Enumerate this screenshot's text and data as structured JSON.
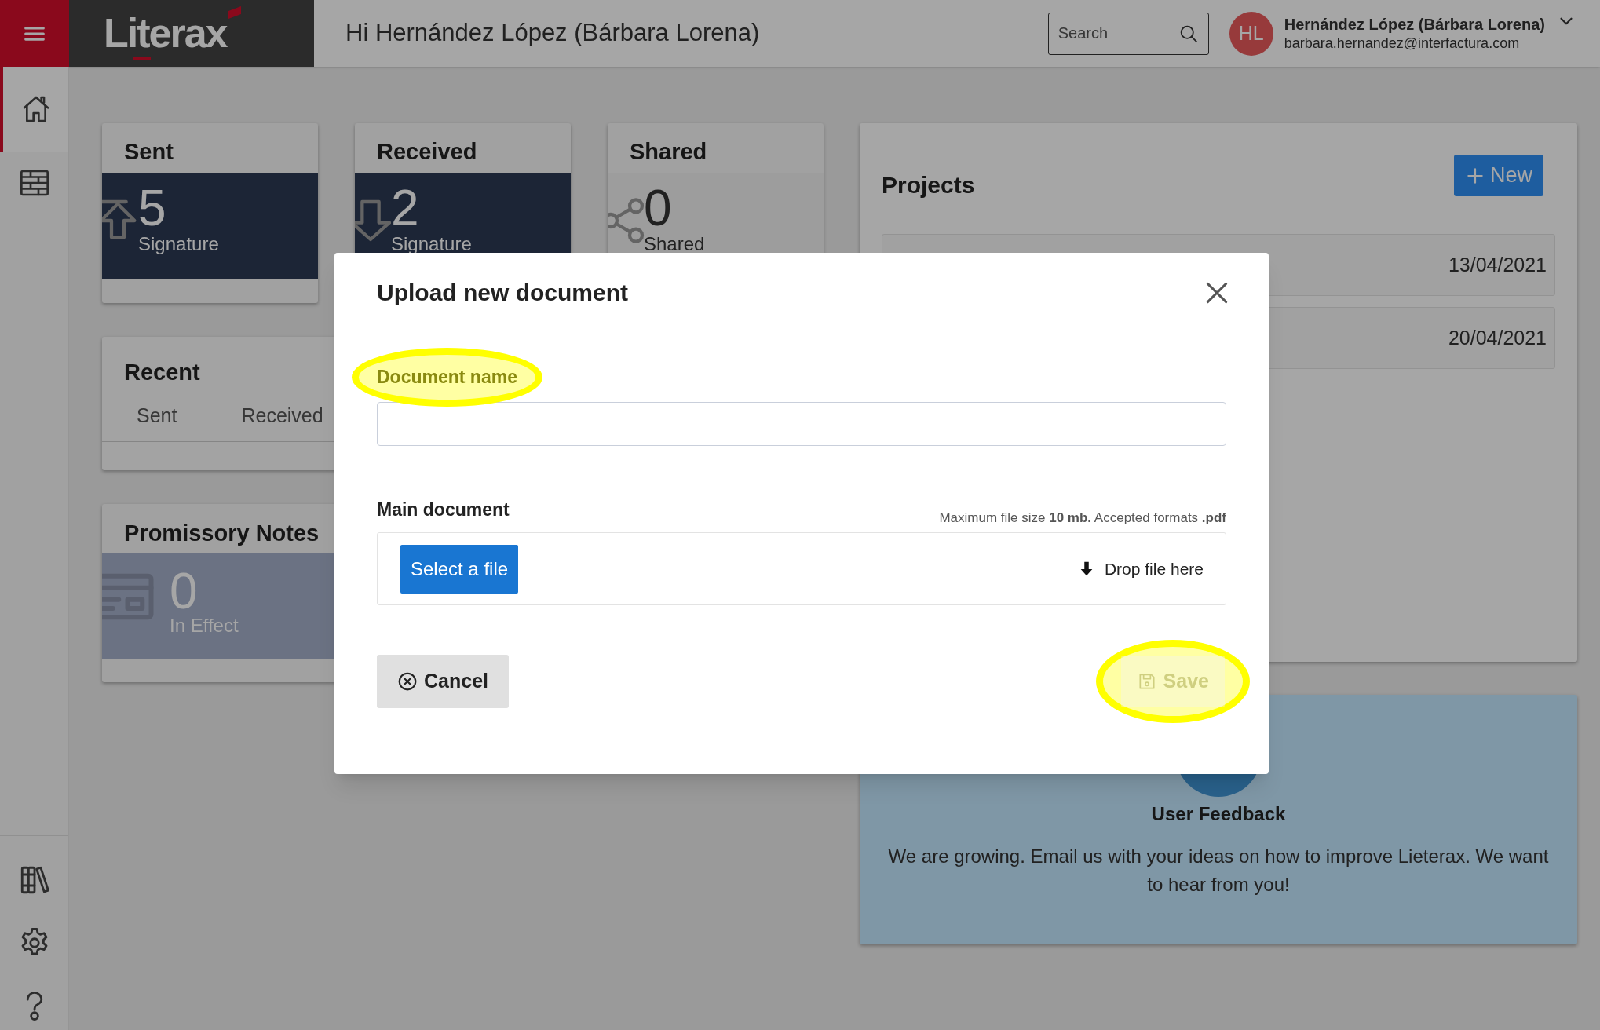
{
  "topbar": {
    "logo": "Literax",
    "greeting": "Hi Hernández López (Bárbara Lorena)",
    "search": {
      "placeholder": "Search"
    },
    "user": {
      "initials": "HL",
      "name": "Hernández López (Bárbara Lorena)",
      "email": "barbara.hernandez@interfactura.com"
    }
  },
  "sidebar": {
    "items": [
      {
        "kind": "home",
        "selected": true
      },
      {
        "kind": "table",
        "selected": false
      }
    ],
    "bottom_items": [
      {
        "kind": "books"
      },
      {
        "kind": "settings"
      },
      {
        "kind": "help"
      }
    ]
  },
  "stat_cards": [
    {
      "kind": "sent",
      "title": "Sent",
      "count": "5",
      "caption": "Signature"
    },
    {
      "kind": "received",
      "title": "Received",
      "count": "2",
      "caption": "Signature"
    },
    {
      "kind": "shared",
      "title": "Shared",
      "count": "0",
      "caption": "Shared"
    }
  ],
  "recent": {
    "title": "Recent",
    "tabs": [
      "Sent",
      "Received"
    ]
  },
  "promissory": {
    "title": "Promissory Notes",
    "count": "0",
    "caption": "In Effect"
  },
  "projects": {
    "title": "Projects",
    "new_button": "New",
    "rows": [
      {
        "date": "13/04/2021"
      },
      {
        "date": "20/04/2021"
      }
    ]
  },
  "feedback": {
    "title": "User Feedback",
    "text": "We are growing. Email us with your ideas on how to improve Lieterax. We want to hear from you!"
  },
  "modal": {
    "title": "Upload new document",
    "name_field": {
      "label": "Document name",
      "highlighted": true
    },
    "file_field": {
      "label": "Main document",
      "hint": "Maximum file size **10 mb.** Accepted formats **.pdf**",
      "select_button": "Select a file",
      "drop_text": "Drop file here"
    },
    "cancel_button": "Cancel",
    "save_button": {
      "label": "Save",
      "disabled": true,
      "highlighted": true
    }
  }
}
